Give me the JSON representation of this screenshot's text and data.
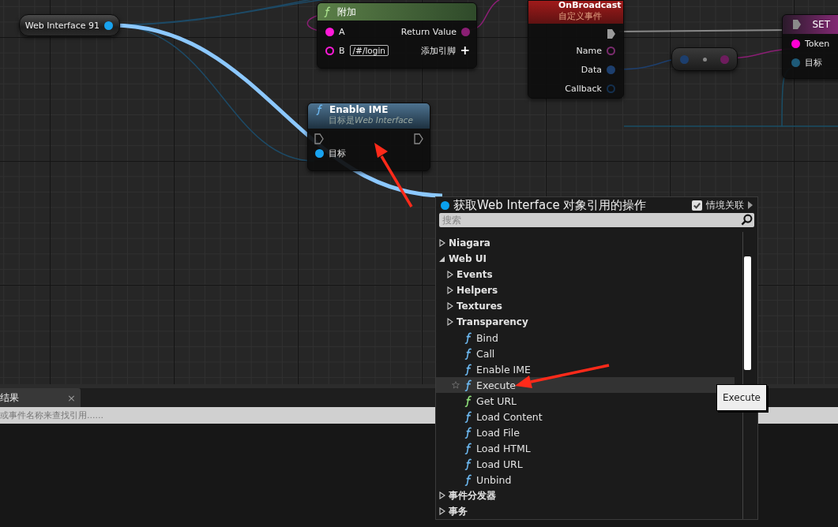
{
  "variable_node": {
    "label": "Web Interface 91"
  },
  "append_node": {
    "title": "附加",
    "inputs": [
      {
        "label": "A",
        "connected": true
      },
      {
        "label": "B",
        "connected": false,
        "value": "/#/login"
      }
    ],
    "output": "Return Value",
    "add_pin": "添加引脚",
    "add_icon": "+"
  },
  "event_node": {
    "title": "OnBroadcast",
    "subtitle": "自定义事件",
    "outputs": [
      {
        "label": "Name",
        "color": "#7a2c6e",
        "connected": false
      },
      {
        "label": "Data",
        "color": "#1d3f6e",
        "connected": true
      },
      {
        "label": "Callback",
        "color": "#14304f",
        "connected": false
      }
    ]
  },
  "set_node": {
    "title": "SET",
    "inputs": [
      {
        "label": "Token",
        "color": "#ff00d4",
        "connected": true
      },
      {
        "label": "目标",
        "color": "#1e5a78",
        "connected": true
      }
    ]
  },
  "function_node": {
    "title": "Enable IME",
    "subtitle": {
      "prefix": "目标是",
      "target": "Web Interface"
    },
    "input": "目标"
  },
  "results_panel": {
    "tab": "结果",
    "close": "×",
    "search_placeholder": "或事件名称来查找引用......"
  },
  "action_menu": {
    "title": "获取Web Interface 对象引用的操作",
    "context_sensitive": {
      "label": "情境关联",
      "checked": true
    },
    "search_placeholder": "搜索",
    "items": [
      {
        "label": "Niagara",
        "kind": "category",
        "expanded": false,
        "selected": false
      },
      {
        "label": "Web UI",
        "kind": "category",
        "expanded": true,
        "selected": false,
        "children": [
          {
            "label": "Events",
            "kind": "category",
            "expanded": false,
            "selected": false
          },
          {
            "label": "Helpers",
            "kind": "category",
            "expanded": false,
            "selected": false
          },
          {
            "label": "Textures",
            "kind": "category",
            "expanded": false,
            "selected": false
          },
          {
            "label": "Transparency",
            "kind": "category",
            "expanded": false,
            "selected": false
          },
          {
            "label": "Bind",
            "kind": "function",
            "selected": false
          },
          {
            "label": "Call",
            "kind": "function",
            "selected": false
          },
          {
            "label": "Enable IME",
            "kind": "function",
            "selected": false
          },
          {
            "label": "Execute",
            "kind": "function",
            "selected": true
          },
          {
            "label": "Get URL",
            "kind": "pure_function",
            "selected": false
          },
          {
            "label": "Load Content",
            "kind": "function",
            "selected": false
          },
          {
            "label": "Load File",
            "kind": "function",
            "selected": false
          },
          {
            "label": "Load HTML",
            "kind": "function",
            "selected": false
          },
          {
            "label": "Load URL",
            "kind": "function",
            "selected": false
          },
          {
            "label": "Unbind",
            "kind": "function",
            "selected": false
          }
        ]
      },
      {
        "label": "事件分发器",
        "kind": "category",
        "expanded": false,
        "selected": false
      },
      {
        "label": "事务",
        "kind": "category",
        "expanded": false,
        "selected": false
      }
    ]
  },
  "tooltip": {
    "text": "Execute"
  }
}
